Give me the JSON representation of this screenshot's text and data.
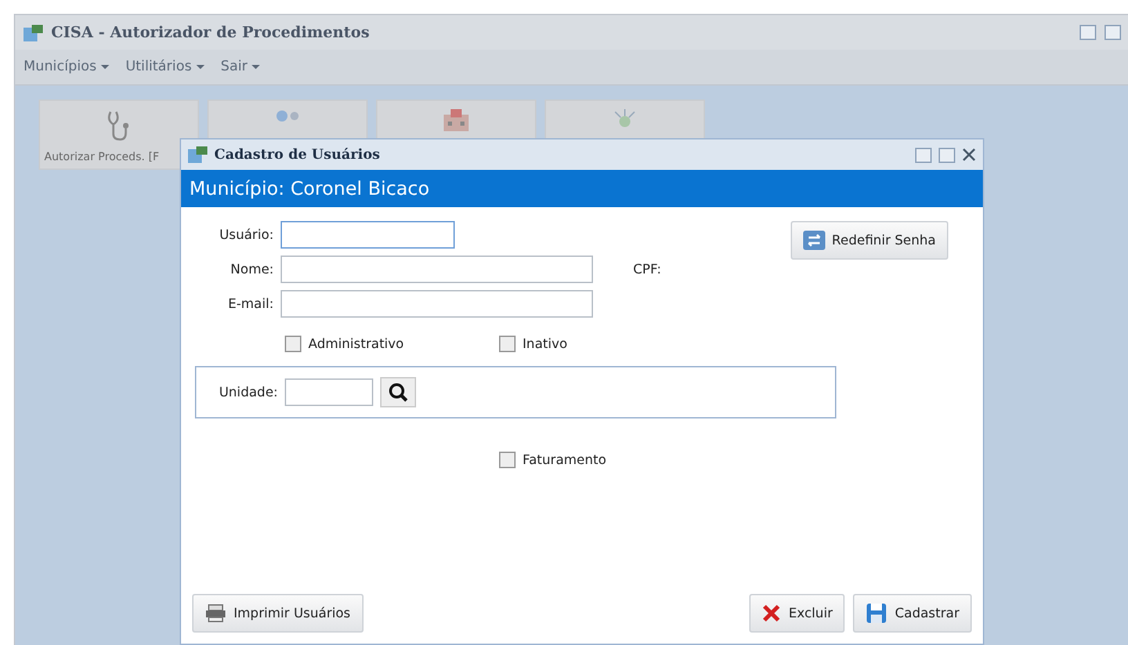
{
  "window": {
    "title": "CISA - Autorizador de Procedimentos"
  },
  "menu": [
    {
      "label": "Municípios"
    },
    {
      "label": "Utilitários"
    },
    {
      "label": "Sair"
    }
  ],
  "tiles": [
    {
      "kind": "stethoscope",
      "label": "Autorizar Proceds. [F"
    },
    {
      "kind": "people"
    },
    {
      "kind": "building"
    },
    {
      "kind": "virus"
    }
  ],
  "dialog": {
    "title": "Cadastro de Usuários",
    "header": "Município: Coronel Bicaco",
    "reset_button": "Redefinir Senha",
    "fields": [
      {
        "label": "Usuário:",
        "focused": true,
        "kind": "short"
      },
      {
        "label": "Nome:",
        "focused": false,
        "kind": "long"
      },
      {
        "label": "E-mail:",
        "focused": false,
        "kind": "long"
      }
    ],
    "cpf_label": "CPF:",
    "checkboxes": [
      {
        "label": "Administrativo",
        "checked": false
      },
      {
        "label": "Inativo",
        "checked": false
      }
    ],
    "unit_label": "Unidade:",
    "billing": {
      "label": "Faturamento",
      "checked": false
    },
    "buttons": [
      {
        "kind": "print",
        "label": "Imprimir Usuários"
      },
      {
        "kind": "delete",
        "label": "Excluir"
      },
      {
        "kind": "save",
        "label": "Cadastrar"
      }
    ]
  }
}
